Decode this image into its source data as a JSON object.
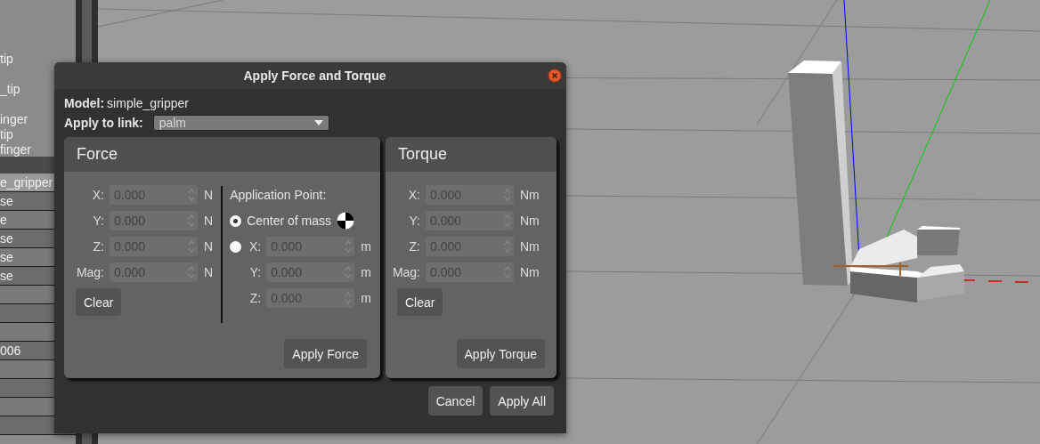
{
  "tree_items": [
    "tip",
    "_tip",
    "inger",
    "tip",
    "finger"
  ],
  "property_rows": [
    {
      "value": "e_gripper",
      "selected": true
    },
    {
      "value": "se",
      "selected": false
    },
    {
      "value": "e",
      "selected": false
    },
    {
      "value": "se",
      "selected": false
    },
    {
      "value": "se",
      "selected": false
    },
    {
      "value": "se",
      "selected": false
    },
    {
      "selected": false
    },
    {
      "selected": false
    },
    {
      "selected": false
    },
    {
      "value": "006",
      "selected": false
    },
    {
      "selected": false
    },
    {
      "selected": false
    },
    {
      "selected": false
    },
    {
      "selected": false
    }
  ],
  "dialog": {
    "title": "Apply Force and Torque",
    "model_label": "Model:",
    "model_value": "simple_gripper",
    "link_label": "Apply to link:",
    "link_value": "palm",
    "force": {
      "title": "Force",
      "fields": [
        {
          "label": "X:",
          "value": "0.000",
          "unit": "N"
        },
        {
          "label": "Y:",
          "value": "0.000",
          "unit": "N"
        },
        {
          "label": "Z:",
          "value": "0.000",
          "unit": "N"
        },
        {
          "label": "Mag:",
          "value": "0.000",
          "unit": "N"
        }
      ],
      "clear": "Clear",
      "application_point": {
        "title": "Application Point:",
        "options": [
          {
            "label": "Center of mass",
            "selected": true
          },
          {
            "selected": false,
            "fields": [
              {
                "label": "X:",
                "value": "0.000",
                "unit": "m"
              },
              {
                "label": "Y:",
                "value": "0.000",
                "unit": "m"
              },
              {
                "label": "Z:",
                "value": "0.000",
                "unit": "m"
              }
            ]
          }
        ]
      },
      "apply": "Apply Force"
    },
    "torque": {
      "title": "Torque",
      "fields": [
        {
          "label": "X:",
          "value": "0.000",
          "unit": "Nm"
        },
        {
          "label": "Y:",
          "value": "0.000",
          "unit": "Nm"
        },
        {
          "label": "Z:",
          "value": "0.000",
          "unit": "Nm"
        },
        {
          "label": "Mag:",
          "value": "0.000",
          "unit": "Nm"
        }
      ],
      "clear": "Clear",
      "apply": "Apply Torque"
    },
    "buttons": [
      "Cancel",
      "Apply All"
    ]
  }
}
